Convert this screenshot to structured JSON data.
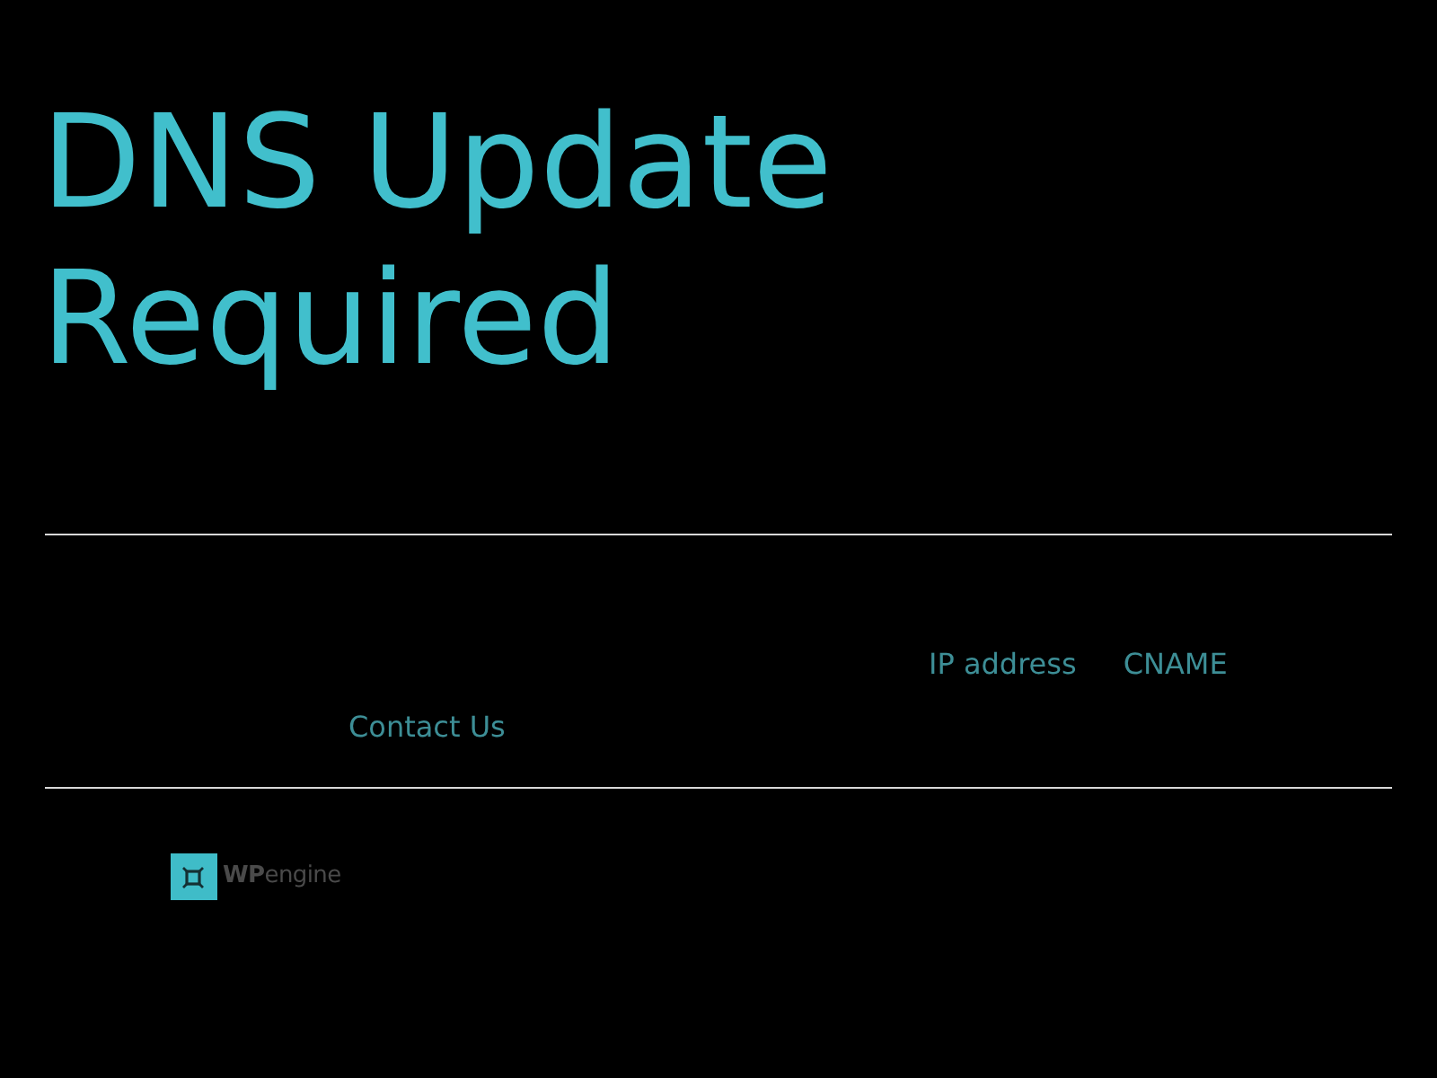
{
  "heading": "DNS Update Required",
  "content": {
    "lines": [
      {
        "links": [
          {
            "label": "IP address"
          },
          {
            "label": "CNAME"
          }
        ]
      },
      {
        "links": [
          {
            "label": "Contact Us"
          }
        ]
      }
    ]
  },
  "footer": {
    "logo_text": "**WP**engine"
  }
}
